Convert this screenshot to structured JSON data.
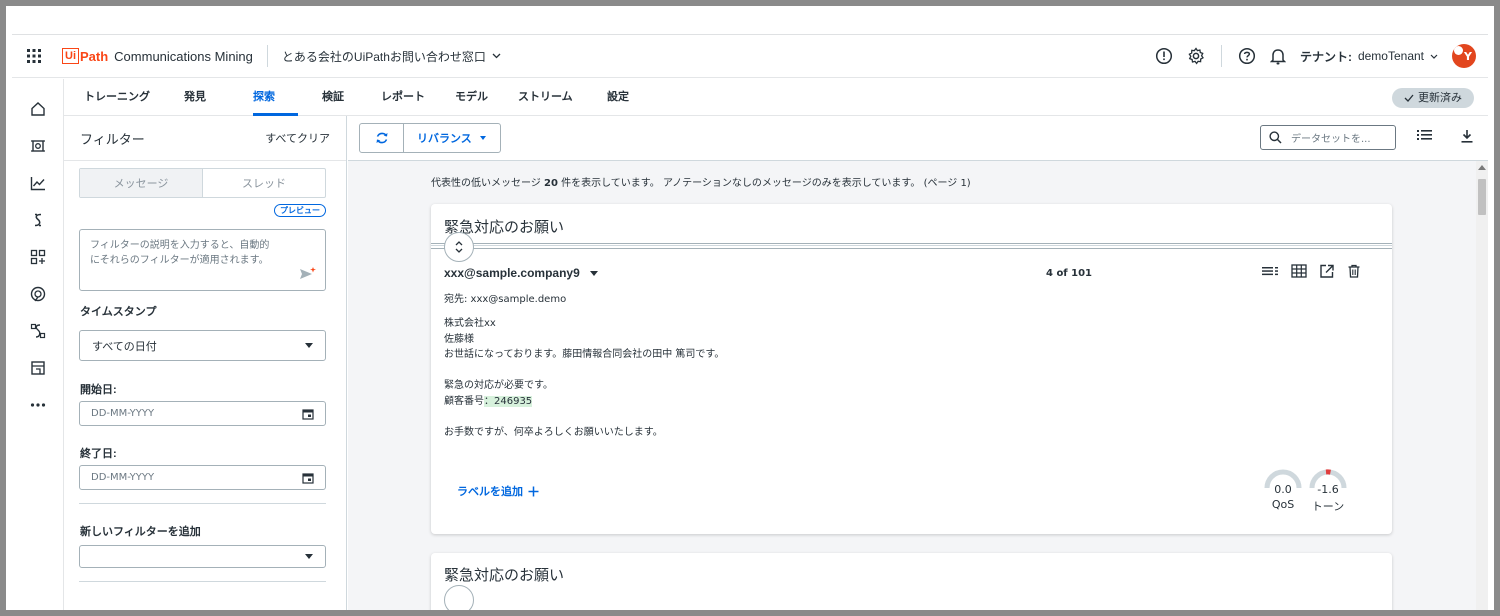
{
  "header": {
    "logo_box": "Ui",
    "logo_path": "Path",
    "product": "Communications Mining",
    "dataset": "とある会社のUiPathお問い合わせ窓口",
    "tenant_label": "テナント:",
    "tenant_value": "demoTenant",
    "avatar_initial": "Y"
  },
  "tabs": [
    {
      "label": "トレーニング"
    },
    {
      "label": "発見"
    },
    {
      "label": "探索",
      "active": true
    },
    {
      "label": "検証"
    },
    {
      "label": "レポート"
    },
    {
      "label": "モデル"
    },
    {
      "label": "ストリーム"
    },
    {
      "label": "設定"
    }
  ],
  "updated_badge": "更新済み",
  "rail_icons": [
    "home-icon",
    "model-icon",
    "reports-icon",
    "streams-icon",
    "apps-icon",
    "discover-icon",
    "integrations-icon",
    "store-icon",
    "more-icon"
  ],
  "filters": {
    "title": "フィルター",
    "clear_all": "すべてクリア",
    "segment_message": "メッセージ",
    "segment_thread": "スレッド",
    "preview_badge": "プレビュー",
    "nl_placeholder_1": "フィルターの説明を入力すると、自動的",
    "nl_placeholder_2": "にそれらのフィルターが適用されます。",
    "timestamp_label": "タイムスタンプ",
    "timestamp_value": "すべての日付",
    "start_label": "開始日:",
    "start_placeholder": "DD-MM-YYYY",
    "end_label": "終了日:",
    "end_placeholder": "DD-MM-YYYY",
    "add_filter_label": "新しいフィルターを追加",
    "add_filter_value": ""
  },
  "toolbar": {
    "rebalance_label": "リバランス",
    "search_placeholder": "データセットを..."
  },
  "summary": {
    "prefix": "代表性の低いメッセージ",
    "count": "20",
    "suffix": "件を表示しています。 アノテーションなしのメッセージのみを表示しています。 (ページ 1)"
  },
  "messages": [
    {
      "subject": "緊急対応のお願い",
      "sender": "xxx@sample.company9",
      "counter": "4 of 101",
      "to": "宛先: xxx@sample.demo",
      "body_lines": [
        "株式会社xx",
        "佐藤様",
        "お世話になっております。藤田情報合同会社の田中 篤司です。",
        "",
        "緊急の対応が必要です。"
      ],
      "customer_prefix": "顧客番号",
      "customer_entity": "：246935",
      "closing": "お手数ですが、何卒よろしくお願いいたします。",
      "add_label": "ラベルを追加",
      "qos_value": "0.0",
      "qos_label": "QoS",
      "qos_level": 0.0,
      "tone_value": "-1.6",
      "tone_label": "トーン",
      "tone_level": -1.6
    },
    {
      "subject": "緊急対応のお願い"
    }
  ]
}
